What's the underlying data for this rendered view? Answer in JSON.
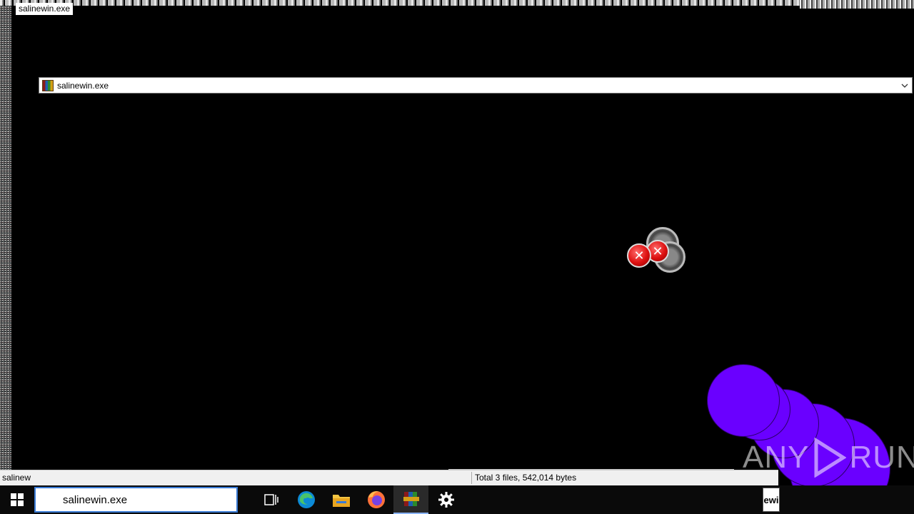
{
  "corner_label": "salinewin.exe",
  "path_bar": {
    "path": "salinewin.exe"
  },
  "status_bar": {
    "left_text": "salinew",
    "right_text": "Total 3 files, 542,014 bytes"
  },
  "taskbar": {
    "search_value": "salinewin.exe",
    "tray_text": "ewi"
  },
  "watermark": {
    "left": "ANY",
    "right": "RUN"
  },
  "colors": {
    "background": "#000000",
    "purple_blob": "#6a00ff",
    "error_red": "#dd1111",
    "taskbar": "#0a0a0a",
    "search_border": "#3a7bd5"
  },
  "icons": {
    "path_bar": "archive-icon",
    "dropdown": "chevron-down-icon",
    "start": "windows-start-icon",
    "task_view": "task-view-icon",
    "edge": "edge-icon",
    "explorer": "file-explorer-icon",
    "firefox": "firefox-icon",
    "winrar": "winrar-icon",
    "settings": "gear-icon",
    "error": "error-x-icon"
  }
}
